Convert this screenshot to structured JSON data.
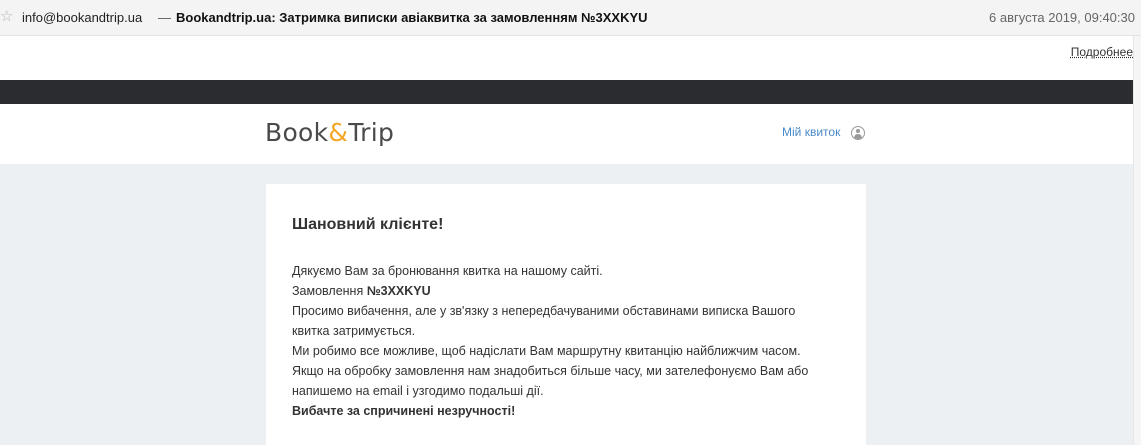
{
  "mail": {
    "from": "info@bookandtrip.ua",
    "separator": "—",
    "subject": "Bookandtrip.ua: Затримка виписки авіаквитка за замовленням №3XXKYU",
    "date": "6 августа 2019, 09:40:30",
    "details_link": "Подробнее"
  },
  "email": {
    "logo": {
      "part1": "Book",
      "amp": "&",
      "part2": "Trip"
    },
    "my_ticket": "Мій квиток",
    "greeting": "Шановний клієнте!",
    "lines": {
      "l1": "Дякуємо Вам за бронювання квитка на нашому сайті.",
      "l2_prefix": "Замовлення ",
      "order_number": "№3XXKYU",
      "l3": "Просимо вибачення, але у зв'язку з непередбачуваними обставинами виписка Вашого",
      "l4": "квитка затримується.",
      "l5": "Ми робимо все можливе, щоб надіслати Вам маршрутну квитанцію найближчим часом.",
      "l6": "Якщо на обробку замовлення нам знадобиться більше часу, ми зателефонуємо Вам або",
      "l7": "напишемо на email і узгодимо подальші дії.",
      "l8": "Вибачте за спричинені незручності!"
    }
  },
  "colors": {
    "logo_accent": "#f5a623",
    "link": "#4a8ac9",
    "topbar": "#2b2c30",
    "email_background": "#edf0f3"
  },
  "icons": {
    "star": "star-icon",
    "user": "user-icon"
  }
}
